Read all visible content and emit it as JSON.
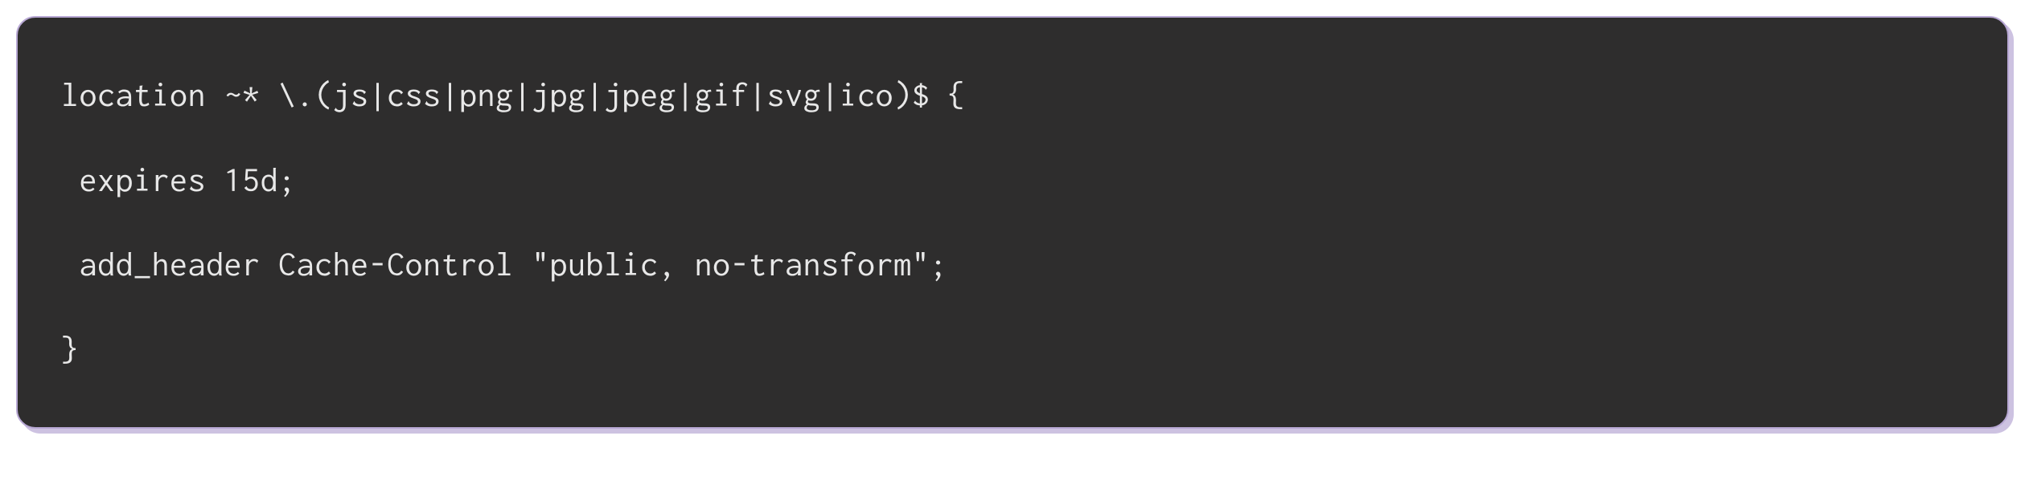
{
  "code": {
    "lines": [
      "location ~* \\.(js|css|png|jpg|jpeg|gif|svg|ico)$ {",
      " expires 15d;",
      " add_header Cache-Control \"public, no-transform\";",
      "}"
    ]
  }
}
